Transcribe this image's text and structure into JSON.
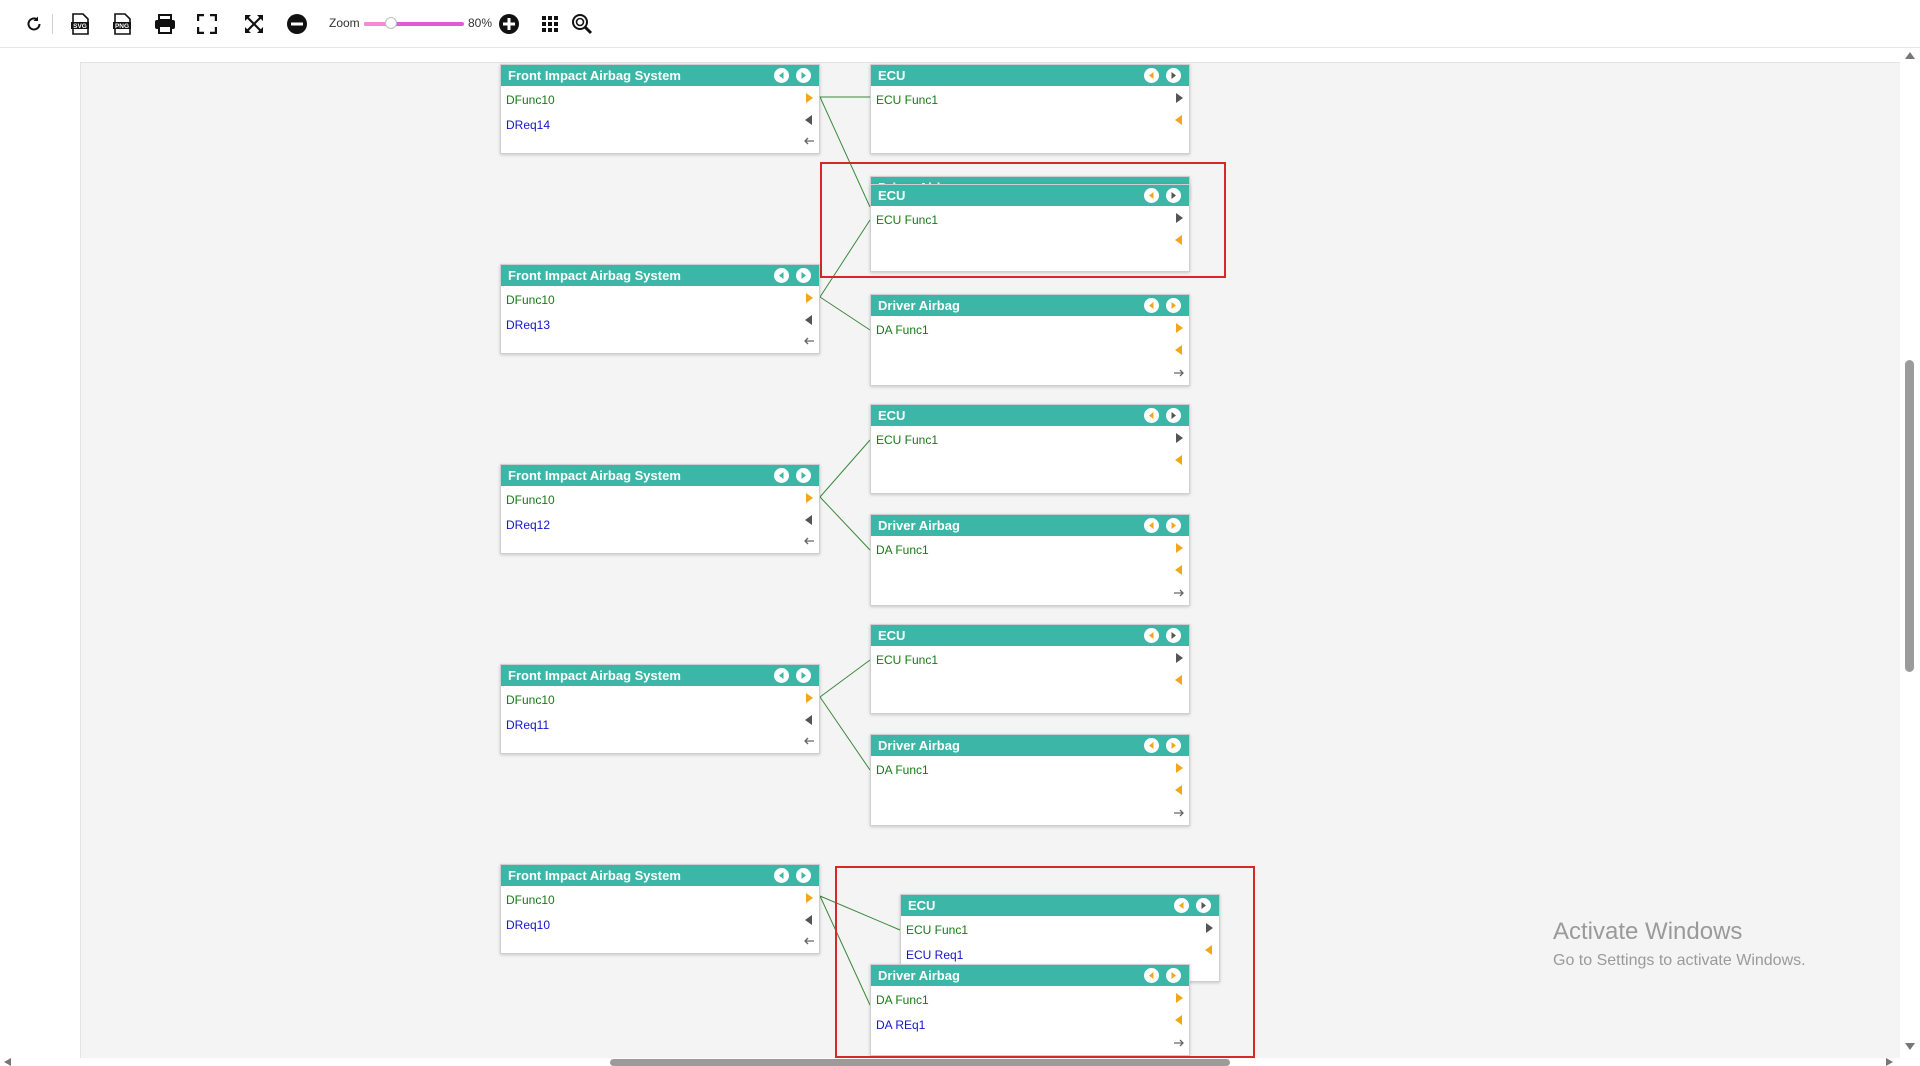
{
  "toolbar": {
    "zoom_label": "Zoom",
    "zoom_value": "80%",
    "zoom_fraction": 0.8,
    "icons": [
      "refresh-icon",
      "svg-export-icon",
      "png-export-icon",
      "print-icon",
      "fit-screen-icon",
      "expand-arrows-icon",
      "zoom-out-icon",
      "zoom-in-icon",
      "grid-icon",
      "zoom-search-icon"
    ],
    "svg_badge": "SVG",
    "png_badge": "PNG"
  },
  "diagram": {
    "colors": {
      "header": "#3cb6a6",
      "func_text": "#167a16",
      "req_text": "#1414c8",
      "link": "#3a8a3a",
      "highlight": "#d62828"
    },
    "groups": [
      {
        "source": {
          "title": "Front Impact Airbag System",
          "func": "DFunc10",
          "req": "DReq14"
        },
        "targets": [
          {
            "title": "ECU",
            "func": "ECU Func1"
          },
          {
            "title": "Driver Airbag",
            "func": "",
            "hidden": true
          },
          {
            "title": "ECU",
            "func": "ECU Func1"
          }
        ]
      },
      {
        "source": {
          "title": "Front Impact Airbag System",
          "func": "DFunc10",
          "req": "DReq13"
        },
        "targets": [
          {
            "title": "Driver Airbag",
            "func": "DA Func1"
          }
        ]
      },
      {
        "source": {
          "title": "Front Impact Airbag System",
          "func": "DFunc10",
          "req": "DReq12"
        },
        "targets": [
          {
            "title": "ECU",
            "func": "ECU Func1"
          },
          {
            "title": "Driver Airbag",
            "func": "DA Func1"
          }
        ]
      },
      {
        "source": {
          "title": "Front Impact Airbag System",
          "func": "DFunc10",
          "req": "DReq11"
        },
        "targets": [
          {
            "title": "ECU",
            "func": "ECU Func1"
          },
          {
            "title": "Driver Airbag",
            "func": "DA Func1"
          }
        ]
      },
      {
        "source": {
          "title": "Front Impact Airbag System",
          "func": "DFunc10",
          "req": "DReq10"
        },
        "targets": [
          {
            "title": "ECU",
            "func": "ECU Func1",
            "req": "ECU Req1"
          },
          {
            "title": "Driver Airbag",
            "func": "DA Func1",
            "req": "DA REq1"
          }
        ]
      }
    ]
  },
  "watermark": {
    "title": "Activate Windows",
    "subtitle": "Go to Settings to activate Windows."
  }
}
